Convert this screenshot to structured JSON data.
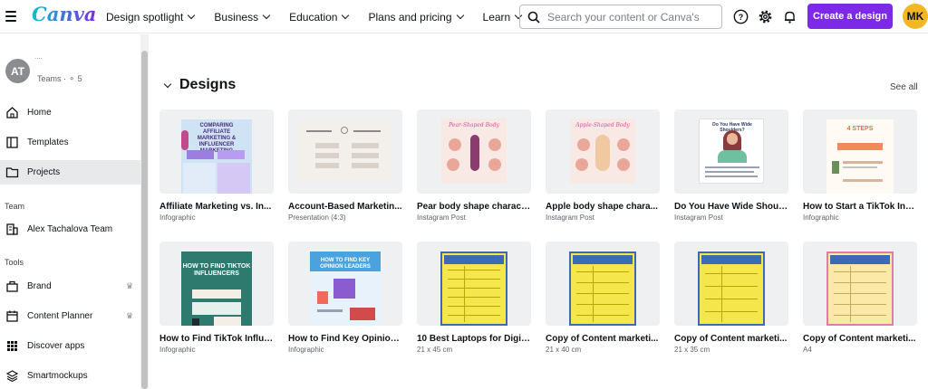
{
  "brand": {
    "logo": "Canva"
  },
  "nav": [
    {
      "label": "Design spotlight"
    },
    {
      "label": "Business"
    },
    {
      "label": "Education"
    },
    {
      "label": "Plans and pricing"
    },
    {
      "label": "Learn"
    }
  ],
  "search": {
    "placeholder": "Search your content or Canva's",
    "value": ""
  },
  "header": {
    "create_label": "Create a design",
    "user_initials": "MK"
  },
  "sidebar": {
    "team": {
      "initials": "AT",
      "name_partial": "....",
      "type": "Teams",
      "members": "5"
    },
    "items": [
      {
        "label": "Home",
        "icon": "home-icon"
      },
      {
        "label": "Templates",
        "icon": "templates-icon"
      },
      {
        "label": "Projects",
        "icon": "folder-icon",
        "active": true
      }
    ],
    "team_section_label": "Team",
    "team_item": {
      "label": "Alex Tachalova Team",
      "icon": "building-icon"
    },
    "tools_section_label": "Tools",
    "tools": [
      {
        "label": "Brand",
        "icon": "brand-icon",
        "crown": true
      },
      {
        "label": "Content Planner",
        "icon": "calendar-icon",
        "crown": true
      },
      {
        "label": "Discover apps",
        "icon": "apps-grid-icon"
      },
      {
        "label": "Smartmockups",
        "icon": "layers-icon"
      }
    ]
  },
  "main": {
    "section_title": "Designs",
    "see_all": "See all",
    "designs": [
      {
        "name": "Affiliate Marketing vs. In...",
        "type": "Infographic",
        "thumb_text": "COMPARING AFFILIATE MARKETING & INFLUENCER MARKETING"
      },
      {
        "name": "Account-Based Marketin...",
        "type": "Presentation (4:3)"
      },
      {
        "name": "Pear body shape charact...",
        "type": "Instagram Post",
        "thumb_text": "Pear-Shaped Body"
      },
      {
        "name": "Apple body shape chara...",
        "type": "Instagram Post",
        "thumb_text": "Apple-Shaped Body"
      },
      {
        "name": "Do You Have Wide Shoul...",
        "type": "Instagram Post",
        "thumb_text": "Do You Have Wide Shoulders?"
      },
      {
        "name": "How to Start a TikTok Infl...",
        "type": "Infographic",
        "thumb_text": "4 STEPS"
      },
      {
        "name": "How to Find TikTok Influe...",
        "type": "Infographic",
        "thumb_text": "HOW TO FIND TIKTOK INFLUENCERS"
      },
      {
        "name": "How to Find Key Opinion ...",
        "type": "Infographic",
        "thumb_text": "HOW TO FIND KEY OPINION LEADERS"
      },
      {
        "name": "10 Best Laptops for Digit...",
        "type": "21 x 45 cm"
      },
      {
        "name": "Copy of Content marketi...",
        "type": "21 x 40 cm"
      },
      {
        "name": "Copy of Content marketi...",
        "type": "21 x 35 cm"
      },
      {
        "name": "Copy of Content marketi...",
        "type": "A4"
      }
    ]
  },
  "colors": {
    "accent": "#7d2ae8",
    "avatar": "#f5b624",
    "active_bg": "#e8e9eb"
  }
}
